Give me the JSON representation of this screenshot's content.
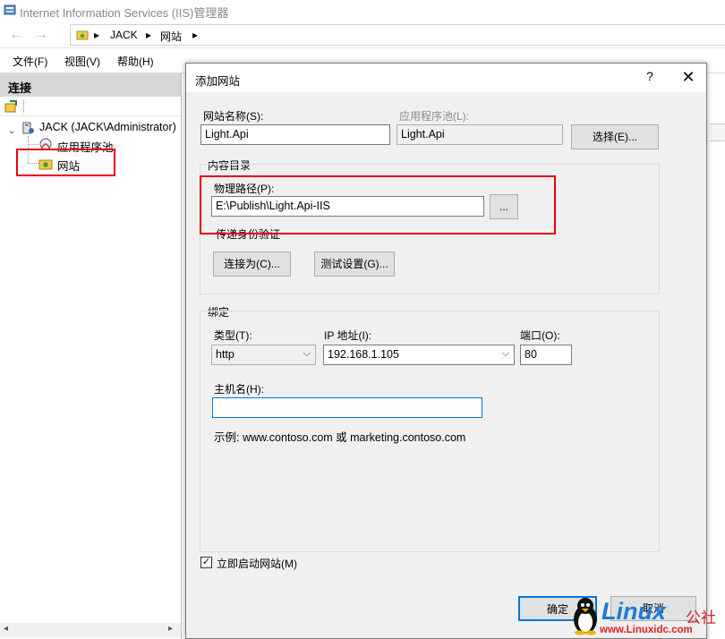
{
  "window": {
    "title": "Internet Information Services (IIS)管理器"
  },
  "address": {
    "crumbs": [
      "JACK",
      "网站"
    ]
  },
  "menu": {
    "items": [
      "文件(F)",
      "视图(V)",
      "帮助(H)"
    ]
  },
  "connections": {
    "header": "连接",
    "tree": {
      "server": "JACK (JACK\\Administrator)",
      "app_pools": "应用程序池",
      "sites": "网站"
    }
  },
  "dialog": {
    "title": "添加网站",
    "help": "?",
    "close": "✕",
    "site_name_label": "网站名称(S):",
    "site_name_value": "Light.Api",
    "app_pool_label": "应用程序池(L):",
    "app_pool_value": "Light.Api",
    "select_button": "选择(E)...",
    "content_dir": {
      "group_label": "内容目录",
      "physical_path_label": "物理路径(P):",
      "physical_path_value": "E:\\Publish\\Light.Api-IIS",
      "browse_button": "...",
      "passthrough_label": "传递身份验证",
      "connect_as_button": "连接为(C)...",
      "test_settings_button": "测试设置(G)..."
    },
    "binding": {
      "group_label": "绑定",
      "type_label": "类型(T):",
      "type_value": "http",
      "ip_label": "IP 地址(I):",
      "ip_value": "192.168.1.105",
      "port_label": "端口(O):",
      "port_value": "80",
      "hostname_label": "主机名(H):",
      "hostname_value": "",
      "example_text": "示例: www.contoso.com 或 marketing.contoso.com"
    },
    "start_immediately_label": "立即启动网站(M)",
    "start_immediately_checked": true,
    "ok_button": "确定",
    "cancel_button": "取消"
  },
  "watermark": {
    "logo": "Linux",
    "cn": "公社",
    "url": "www.Linuxidc.com"
  },
  "colors": {
    "highlight_red": "#e60012",
    "accent_blue": "#0078d7",
    "panel_header": "#d7d7d7"
  }
}
